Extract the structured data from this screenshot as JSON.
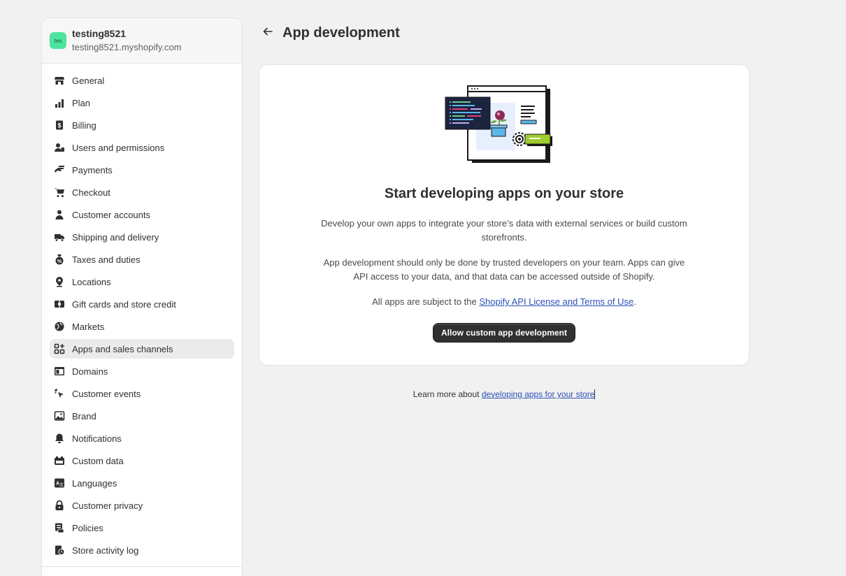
{
  "store": {
    "avatar_text": "tes",
    "name": "testing8521",
    "domain": "testing8521.myshopify.com"
  },
  "sidebar": {
    "items": [
      {
        "label": "General",
        "icon": "store-icon"
      },
      {
        "label": "Plan",
        "icon": "plan-icon"
      },
      {
        "label": "Billing",
        "icon": "billing-icon"
      },
      {
        "label": "Users and permissions",
        "icon": "users-icon"
      },
      {
        "label": "Payments",
        "icon": "payments-icon"
      },
      {
        "label": "Checkout",
        "icon": "cart-icon"
      },
      {
        "label": "Customer accounts",
        "icon": "person-icon"
      },
      {
        "label": "Shipping and delivery",
        "icon": "truck-icon"
      },
      {
        "label": "Taxes and duties",
        "icon": "tax-icon"
      },
      {
        "label": "Locations",
        "icon": "location-icon"
      },
      {
        "label": "Gift cards and store credit",
        "icon": "gift-card-icon"
      },
      {
        "label": "Markets",
        "icon": "globe-icon"
      },
      {
        "label": "Apps and sales channels",
        "icon": "apps-icon",
        "active": true
      },
      {
        "label": "Domains",
        "icon": "domain-icon"
      },
      {
        "label": "Customer events",
        "icon": "cursor-icon"
      },
      {
        "label": "Brand",
        "icon": "brand-icon"
      },
      {
        "label": "Notifications",
        "icon": "bell-icon"
      },
      {
        "label": "Custom data",
        "icon": "custom-data-icon"
      },
      {
        "label": "Languages",
        "icon": "language-icon"
      },
      {
        "label": "Customer privacy",
        "icon": "lock-icon"
      },
      {
        "label": "Policies",
        "icon": "policy-icon"
      },
      {
        "label": "Store activity log",
        "icon": "activity-log-icon"
      }
    ]
  },
  "page": {
    "title": "App development"
  },
  "card": {
    "heading": "Start developing apps on your store",
    "p1": "Develop your own apps to integrate your store’s data with external services or build custom storefronts.",
    "p2": "App development should only be done by trusted developers on your team. Apps can give API access to your data, and that data can be accessed outside of Shopify.",
    "p3_prefix": "All apps are subject to the ",
    "p3_link": "Shopify API License and Terms of Use",
    "p3_suffix": ".",
    "button": "Allow custom app development"
  },
  "footer": {
    "prefix": "Learn more about ",
    "link": "developing apps for your store"
  },
  "colors": {
    "background": "#f1f1f1",
    "primary_button": "#303030",
    "link": "#2c4fb8",
    "avatar": "#4fe3a0"
  }
}
